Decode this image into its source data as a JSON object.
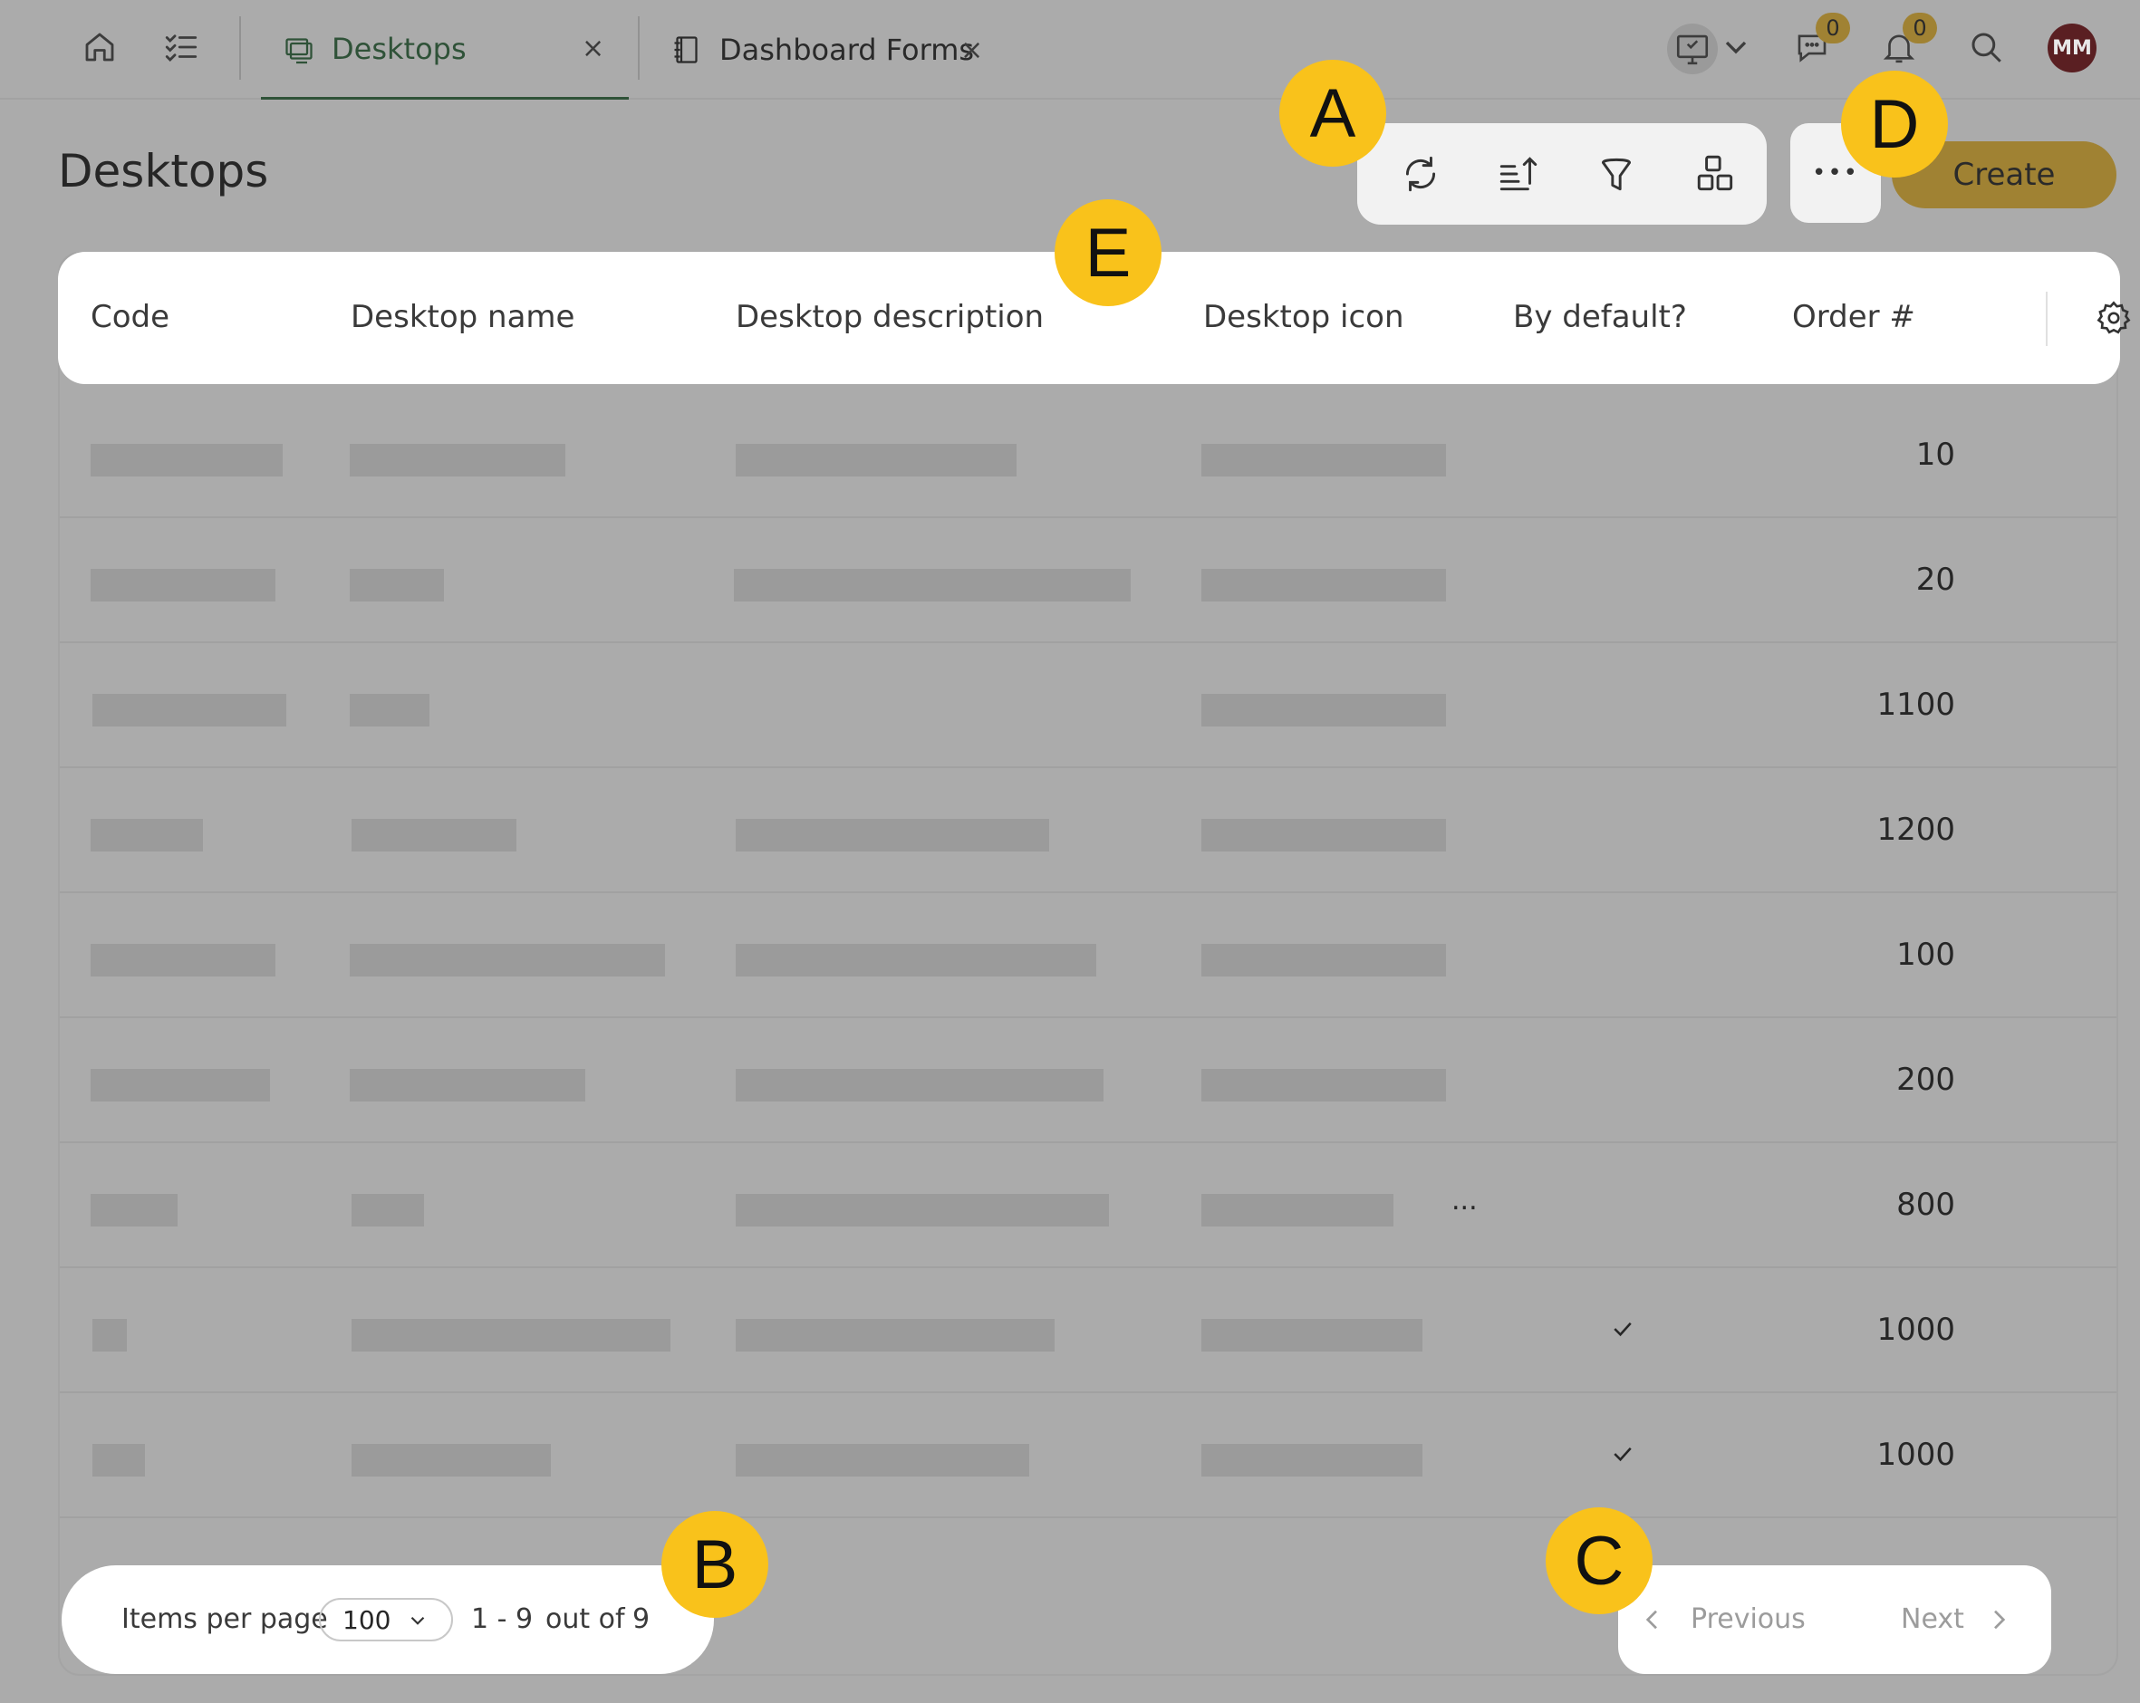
{
  "nav": {
    "home_icon": "home-icon",
    "tasks_icon": "checklist-icon",
    "tabs": [
      {
        "label": "Desktops",
        "icon": "desktop-icon",
        "close": "×",
        "active": true
      },
      {
        "label": "Dashboard Forms",
        "icon": "notebook-icon",
        "close": "×",
        "active": false
      }
    ],
    "chat_badge": "0",
    "notification_badge": "0",
    "avatar_initials": "MM"
  },
  "page": {
    "title": "Desktops",
    "create_label": "Create",
    "more_label": "•••"
  },
  "table": {
    "columns": [
      "Code",
      "Desktop name",
      "Desktop description",
      "Desktop icon",
      "By default?",
      "Order #"
    ],
    "rows": [
      {
        "order": "10",
        "default": false
      },
      {
        "order": "20",
        "default": false
      },
      {
        "order": "1100",
        "default": false
      },
      {
        "order": "1200",
        "default": false
      },
      {
        "order": "100",
        "default": false
      },
      {
        "order": "200",
        "default": false
      },
      {
        "order": "800",
        "default": false,
        "icon_truncated": "..."
      },
      {
        "order": "1000",
        "default": true
      },
      {
        "order": "1000",
        "default": true
      }
    ]
  },
  "pagination": {
    "items_per_page_label": "Items per page",
    "items_per_page_value": "100",
    "range": "1 - 9",
    "out_of_label": "out of",
    "total": "9",
    "previous_label": "Previous",
    "next_label": "Next"
  },
  "callouts": [
    "A",
    "B",
    "C",
    "D",
    "E"
  ],
  "colors": {
    "accent": "#a08233",
    "active_tab": "#2f5238",
    "callout": "#f9c21b",
    "avatar": "#5a1f22"
  }
}
